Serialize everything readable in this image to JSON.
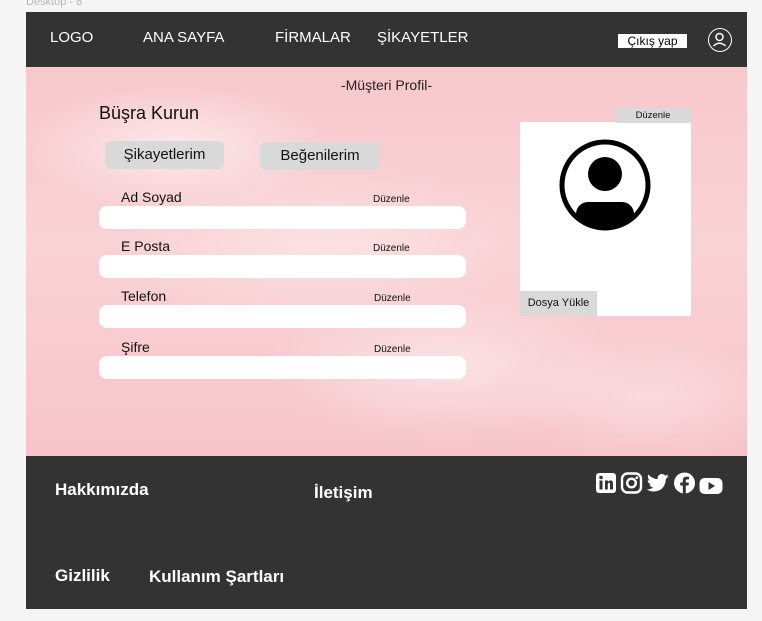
{
  "frame": {
    "label": "Desktop - 8"
  },
  "nav": {
    "logo": "LOGO",
    "home": "ANA SAYFA",
    "companies": "FİRMALAR",
    "complaints": "ŞİKAYETLER",
    "logout": "Çıkış yap",
    "profile_icon": "user-circle-icon"
  },
  "profile": {
    "title": "-Müşteri Profil-",
    "user_name": "Büşra Kurun",
    "tabs": {
      "complaints": "Şikayetlerim",
      "likes": "Beğenilerim"
    },
    "fields": [
      {
        "label": "Ad Soyad",
        "edit": "Düzenle",
        "value": ""
      },
      {
        "label": "E Posta",
        "edit": "Düzenle",
        "value": ""
      },
      {
        "label": "Telefon",
        "edit": "Düzenle",
        "value": ""
      },
      {
        "label": "Şifre",
        "edit": "Düzenle",
        "value": ""
      }
    ],
    "avatar": {
      "edit": "Düzenle",
      "upload": "Dosya Yükle",
      "icon": "user-avatar-icon"
    }
  },
  "footer": {
    "about": "Hakkımızda",
    "contact": "İletişim",
    "privacy": "Gizlilik",
    "terms": "Kullanım Şartları",
    "social": [
      "linkedin-icon",
      "instagram-icon",
      "twitter-icon",
      "facebook-icon",
      "youtube-icon"
    ]
  },
  "colors": {
    "dark": "#333333",
    "pink": "#f7c8cc",
    "gray_button": "#d9d9d9"
  }
}
